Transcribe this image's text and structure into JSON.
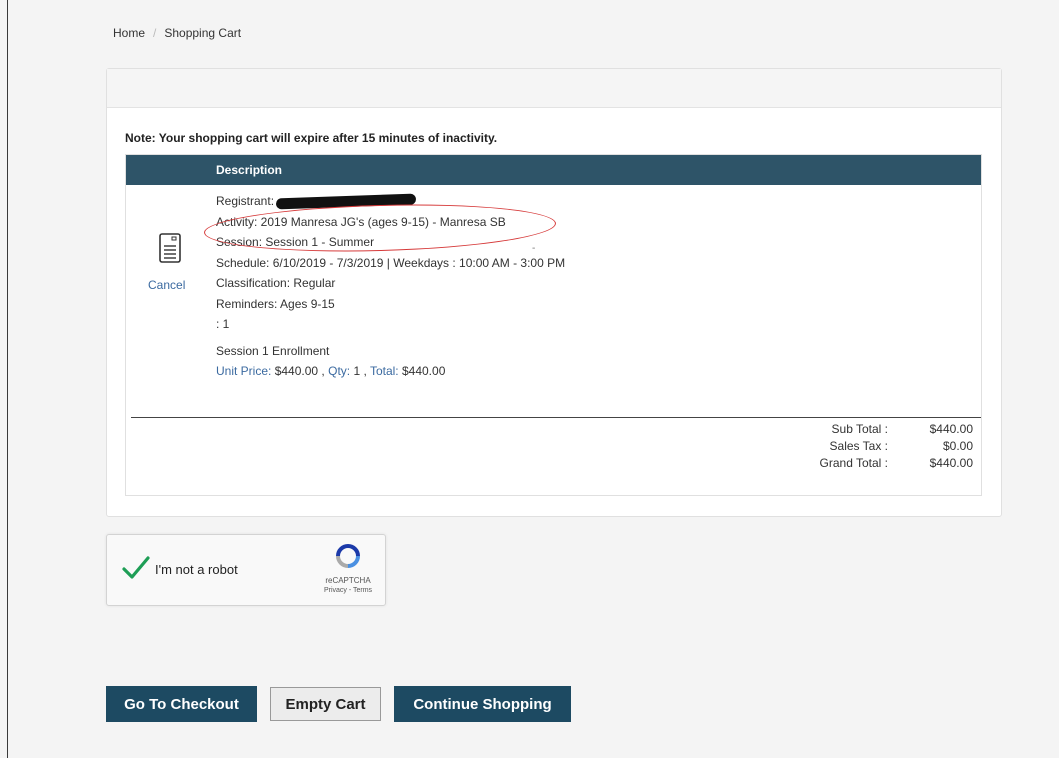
{
  "breadcrumb": {
    "home": "Home",
    "current": "Shopping Cart"
  },
  "note": "Note: Your shopping cart will expire after 15 minutes of inactivity.",
  "table": {
    "header": "Description"
  },
  "item": {
    "cancel_label": "Cancel",
    "registrant_label": "Registrant:",
    "activity": "Activity: 2019 Manresa JG's (ages 9-15) - Manresa SB",
    "session": "Session: Session 1 - Summer",
    "schedule": "Schedule: 6/10/2019 - 7/3/2019 | Weekdays : 10:00 AM - 3:00 PM",
    "classification": "Classification: Regular",
    "reminders": "Reminders: Ages 9-15",
    "extra": ": 1",
    "dash": "-",
    "enrollment": "Session 1 Enrollment",
    "unit_price_label": "Unit Price:",
    "unit_price": "$440.00",
    "qty_label": "Qty:",
    "qty": "1",
    "total_label": "Total:",
    "total": "$440.00"
  },
  "totals": {
    "subtotal_label": "Sub Total :",
    "subtotal": "$440.00",
    "tax_label": "Sales Tax :",
    "tax": "$0.00",
    "grand_label": "Grand Total :",
    "grand": "$440.00"
  },
  "recaptcha": {
    "label": "I'm not a robot",
    "brand": "reCAPTCHA",
    "terms": "Privacy - Terms"
  },
  "buttons": {
    "checkout": "Go To Checkout",
    "empty": "Empty Cart",
    "continue": "Continue Shopping"
  },
  "colors": {
    "header_bg": "#2e5468",
    "button_bg": "#1d4a62",
    "link": "#3b6aa0",
    "annotation": "#d63a3a"
  }
}
